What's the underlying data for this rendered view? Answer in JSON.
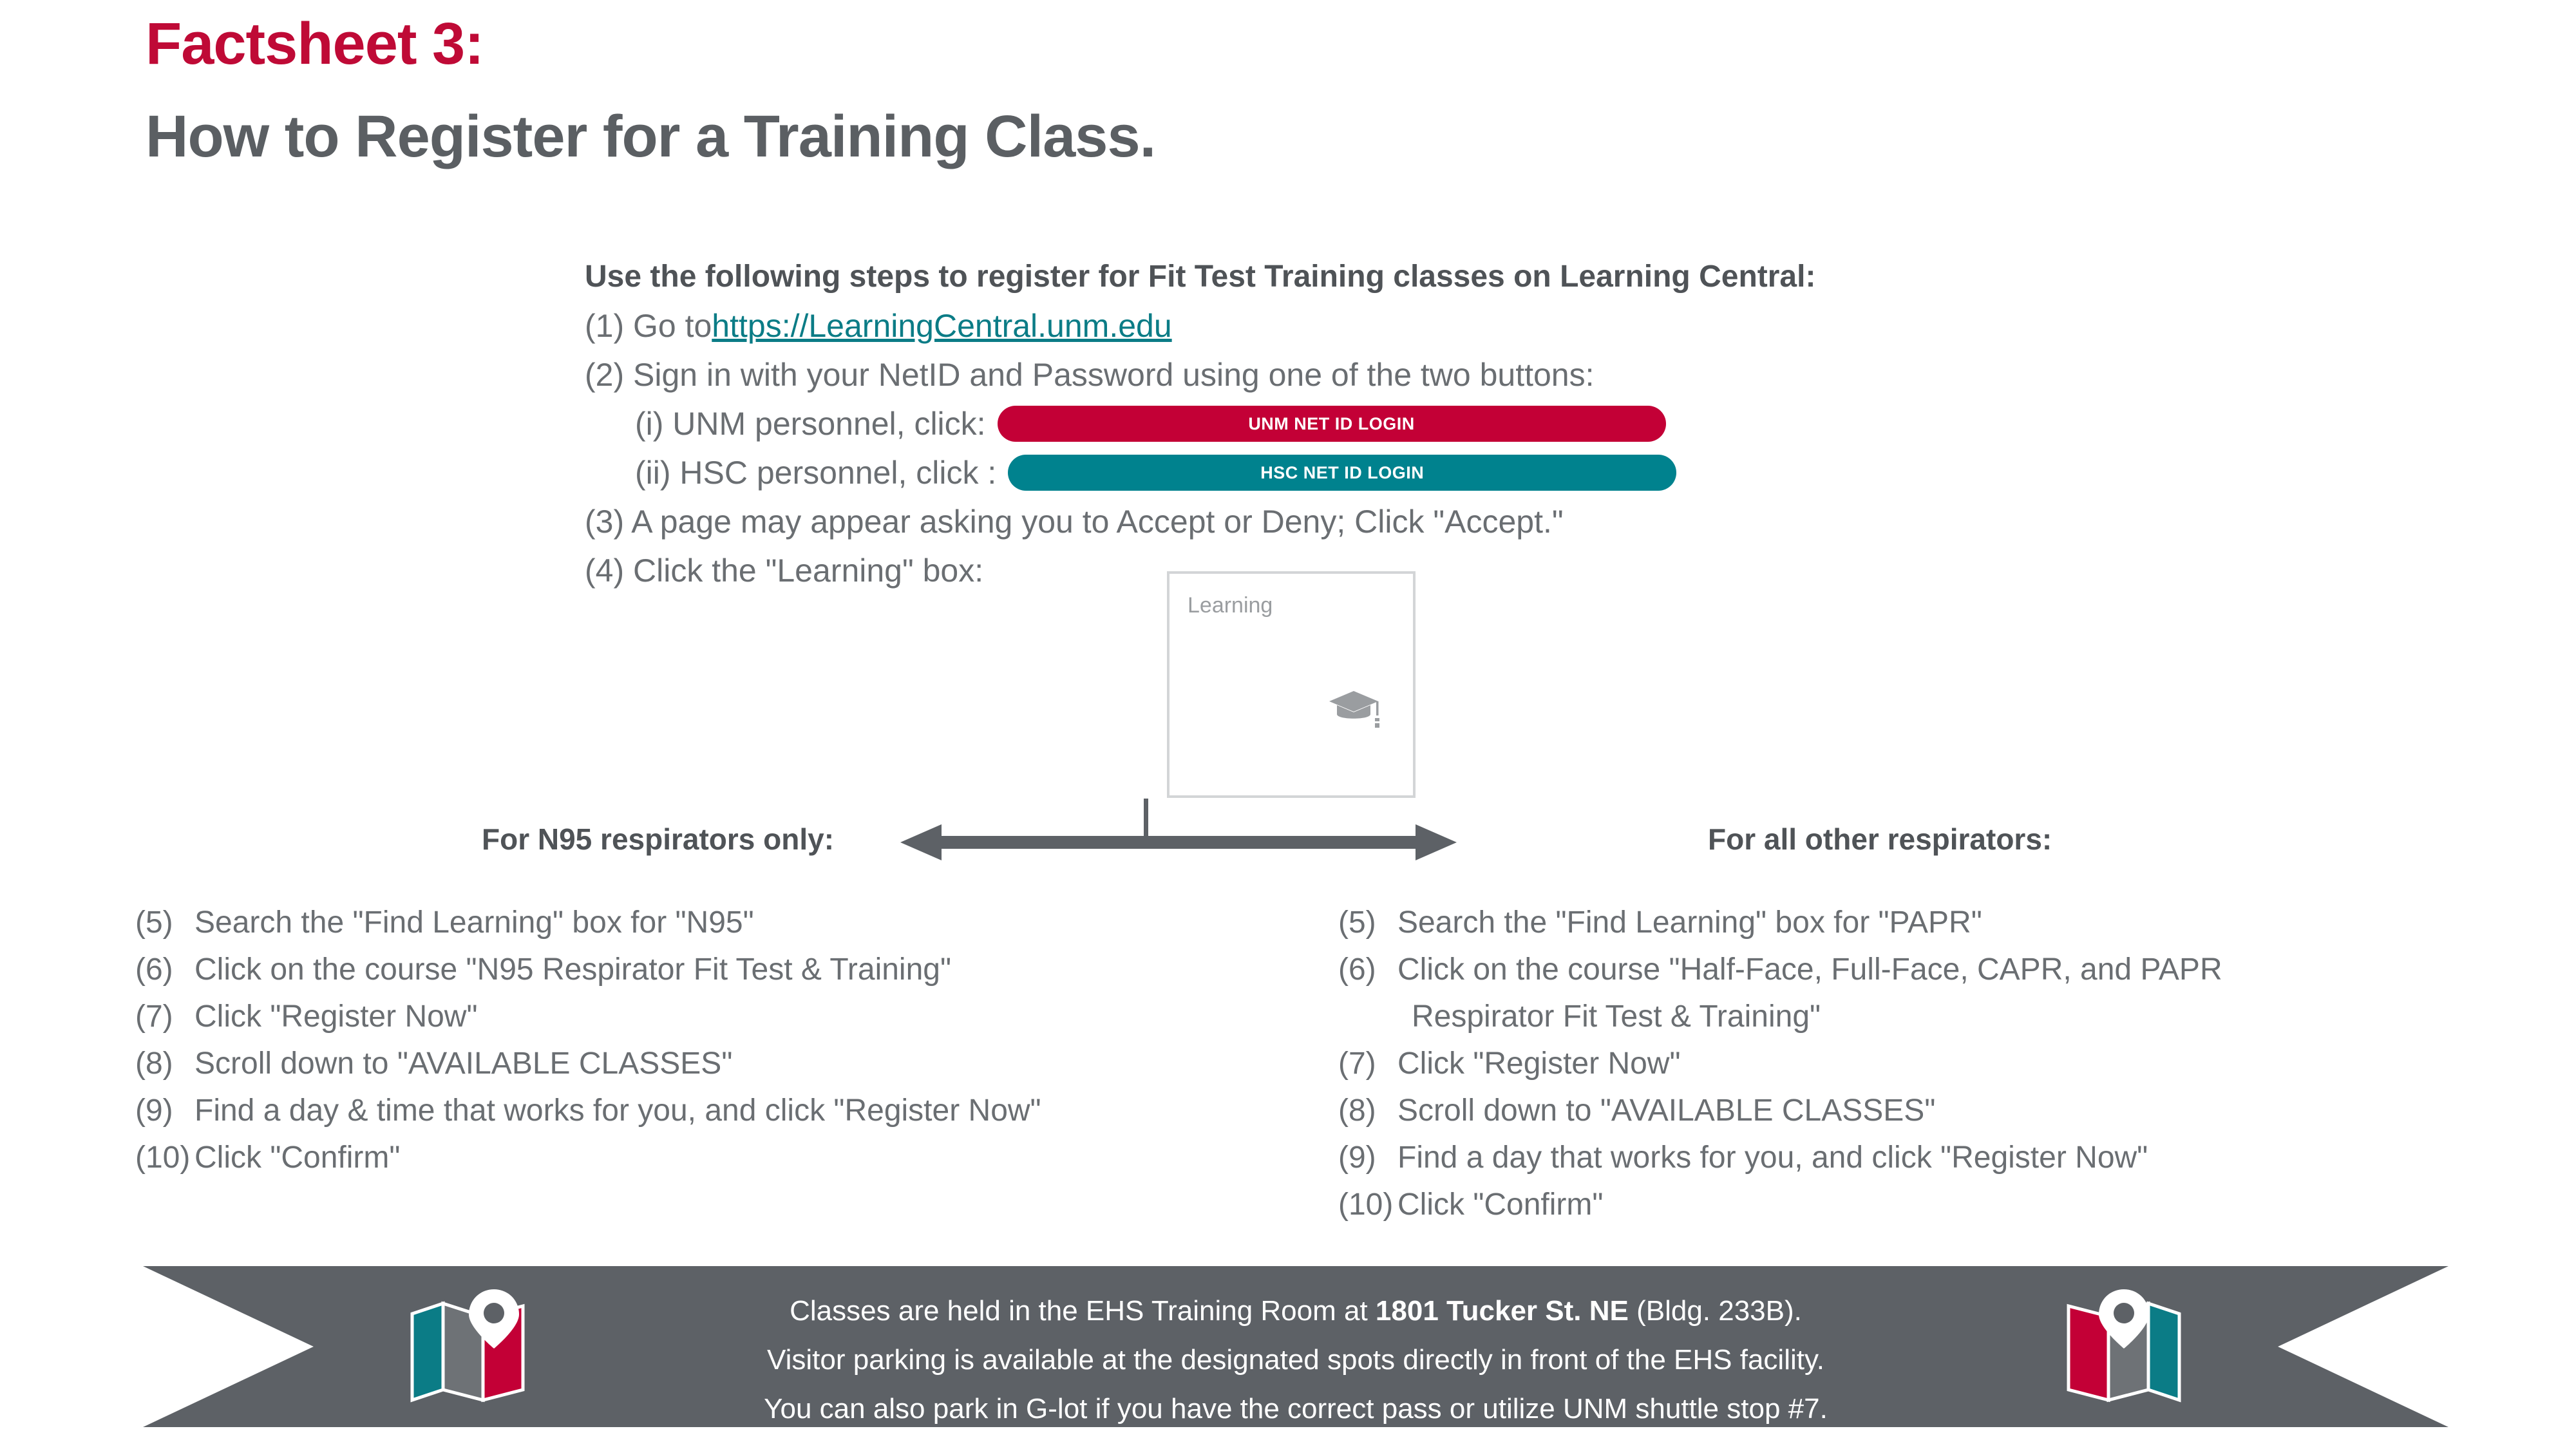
{
  "title": {
    "line1": "Factsheet 3:",
    "line2": "How to Register for a Training Class.",
    "accent_color": "#bf0a36",
    "gray_color": "#5b5f63"
  },
  "instructions": {
    "heading": "Use the following steps to register for Fit Test Training classes on Learning Central:",
    "step1_prefix": "(1) Go to ",
    "step1_link": "https://LearningCentral.unm.edu",
    "step2": "(2) Sign in with your NetID and Password using one of the two buttons:",
    "sub_i_label": "(i)  UNM personnel, click:",
    "sub_i_button": "UNM NET ID LOGIN",
    "sub_i_button_color": "#c30036",
    "sub_ii_label": "(ii) HSC personnel, click :",
    "sub_ii_button": "HSC NET ID LOGIN",
    "sub_ii_button_color": "#00828e",
    "step3": "(3) A page may appear asking you to Accept or Deny; Click \"Accept.\"",
    "step4": "(4) Click the \"Learning\" box:"
  },
  "tile": {
    "label": "Learning",
    "icon": "graduation-cap-icon"
  },
  "branch": {
    "left_label": "For N95 respirators only:",
    "right_label": "For all other respirators:"
  },
  "left_column": {
    "steps": [
      {
        "num": "(5)",
        "text": "Search the \"Find Learning\" box for \"N95\""
      },
      {
        "num": "(6)",
        "text": "Click on the course \"N95 Respirator Fit Test & Training\""
      },
      {
        "num": "(7)",
        "text": " Click \"Register Now\""
      },
      {
        "num": "(8)",
        "text": "Scroll down to \"AVAILABLE CLASSES\""
      },
      {
        "num": "(9)",
        "text": "Find a day & time that works for you, and click \"Register Now\""
      },
      {
        "num": "(10)",
        "text": "Click \"Confirm\""
      }
    ]
  },
  "right_column": {
    "steps": [
      {
        "num": "(5)",
        "text": "Search the \"Find Learning\" box for \"PAPR\""
      },
      {
        "num": "(6)",
        "text": " Click on the course \"Half-Face, Full-Face, CAPR, and PAPR",
        "cont": "Respirator Fit Test & Training\""
      },
      {
        "num": "(7)",
        "text": "Click \"Register Now\""
      },
      {
        "num": "(8)",
        "text": " Scroll down to \"AVAILABLE CLASSES\""
      },
      {
        "num": "(9)",
        "text": " Find a day that works for you, and click \"Register Now\""
      },
      {
        "num": "(10)",
        "text": "Click \"Confirm\""
      }
    ]
  },
  "ribbon": {
    "background_color": "#5d6166",
    "line1_a": "Classes are held in the EHS Training Room at ",
    "line1_bold": "1801 Tucker St. NE",
    "line1_b": " (Bldg. 233B).",
    "line2": "Visitor parking is available at the designated spots directly in front of the EHS facility.",
    "line3": "You can also park in G-lot if you have the correct pass or utilize UNM shuttle stop #7.",
    "icon_left": "map-pin-icon",
    "icon_right": "map-pin-icon",
    "icon_teal": "#0b7c86",
    "icon_crimson": "#c30036"
  }
}
